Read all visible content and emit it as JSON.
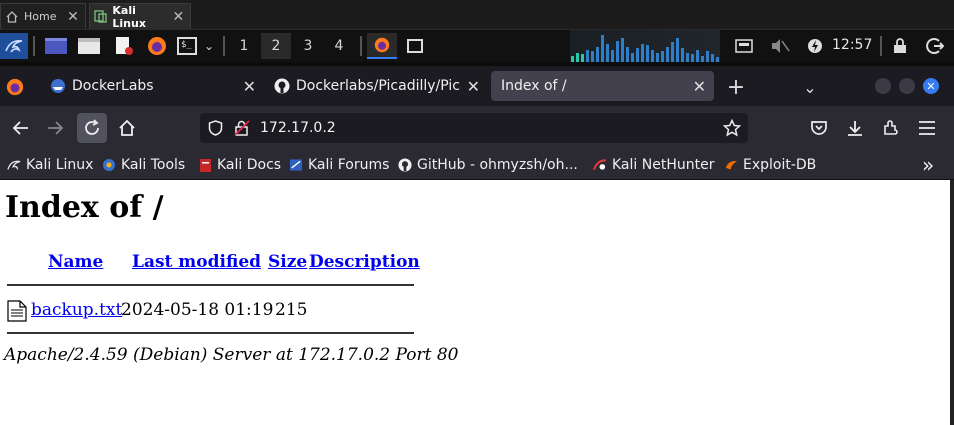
{
  "vm_tabs": [
    {
      "label": "Home",
      "active": false
    },
    {
      "label": "Kali Linux",
      "active": true
    }
  ],
  "panel": {
    "workspaces": [
      "1",
      "2",
      "3",
      "4"
    ],
    "active_workspace": "2",
    "clock": "12:57",
    "visualizer_levels": [
      0.2,
      0.3,
      0.25,
      0.4,
      0.35,
      0.5,
      0.9,
      0.6,
      0.4,
      0.7,
      0.8,
      0.5,
      0.3,
      0.45,
      0.6,
      0.55,
      0.4,
      0.3,
      0.35,
      0.5,
      0.65,
      0.8,
      0.45,
      0.3,
      0.25,
      0.4,
      0.2,
      0.35,
      0.25,
      0.15
    ]
  },
  "browser": {
    "tabs": [
      {
        "label": "DockerLabs",
        "icon": "dockerlabs-favicon",
        "active": false
      },
      {
        "label": "Dockerlabs/Picadilly/Picadilly",
        "icon": "github-favicon",
        "active": false
      },
      {
        "label": "Index of /",
        "icon": "",
        "active": true
      }
    ],
    "new_tab_label": "+",
    "url": "172.17.0.2",
    "bookmarks": [
      {
        "label": "Kali Linux",
        "icon": "kali-dragon-icon"
      },
      {
        "label": "Kali Tools",
        "icon": "kali-tools-icon"
      },
      {
        "label": "Kali Docs",
        "icon": "kali-docs-icon"
      },
      {
        "label": "Kali Forums",
        "icon": "kali-forums-icon"
      },
      {
        "label": "GitHub - ohmyzsh/oh...",
        "icon": "github-icon"
      },
      {
        "label": "Kali NetHunter",
        "icon": "nethunter-icon"
      },
      {
        "label": "Exploit-DB",
        "icon": "exploitdb-icon"
      }
    ],
    "overflow_label": "»"
  },
  "page": {
    "title": "Index of /",
    "columns": [
      "Name",
      "Last modified",
      "Size",
      "Description"
    ],
    "rows": [
      {
        "name": "backup.txt",
        "modified": "2024-05-18 01:19",
        "size": "215",
        "description": ""
      }
    ],
    "address": "Apache/2.4.59 (Debian) Server at 172.17.0.2 Port 80"
  },
  "colors": {
    "link": "#0000ee",
    "kali_blue": "#367bf0",
    "toolbar": "#2b2a33",
    "tabbar": "#1c1b22"
  }
}
